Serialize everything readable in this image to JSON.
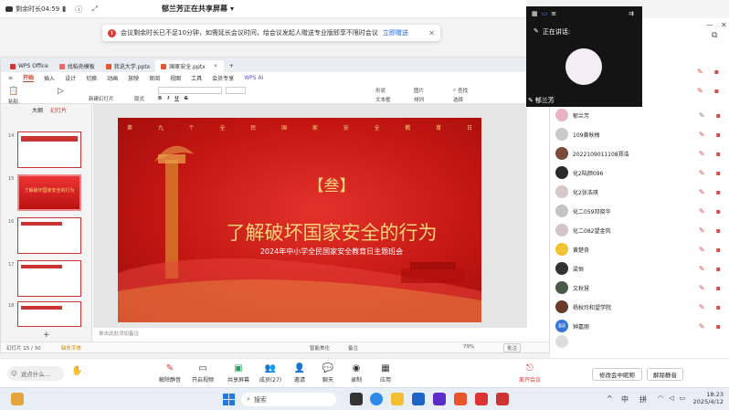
{
  "topbar": {
    "timer": "剩余时长04:59",
    "sharing": "郁兰芳正在共享屏幕"
  },
  "notice": {
    "text": "会议剩余时长已不足10分钟，如需延长会议时间，给会议发起人赠送专业版即享不限时会议",
    "link": "立即赠送"
  },
  "wps": {
    "tabs": [
      {
        "label": "WPS Office"
      },
      {
        "label": "找稻壳模板"
      },
      {
        "label": "我说大学.pptx"
      },
      {
        "label": "国家安全.pptx"
      }
    ],
    "menu": [
      "开始",
      "插入",
      "设计",
      "切换",
      "动画",
      "放映",
      "审阅",
      "视图",
      "工具",
      "会员专享",
      "WPS AI"
    ],
    "ribbon": {
      "paste": "粘贴",
      "new_slide": "新建幻灯片",
      "arrange": "排列",
      "shape": "形状",
      "picture": "图片",
      "textbox": "文本框",
      "find": "查找",
      "layout": "版式",
      "select": "选择"
    },
    "panel": {
      "outline": "大纲",
      "slides": "幻灯片"
    },
    "thumb_numbers": [
      "14",
      "15",
      "16",
      "17",
      "18"
    ],
    "slide": {
      "topline": [
        "第",
        "九",
        "个",
        "全",
        "民",
        "国",
        "家",
        "安",
        "全",
        "教",
        "育",
        "日"
      ],
      "badge": "【叁】",
      "title": "了解破坏国家安全的行为",
      "subtitle": "2024年中小学全民国家安全教育日主题班会"
    },
    "notes": "单击此处添加备注",
    "status": {
      "page": "幻灯片 15 / 30",
      "font": "缺失字体",
      "beautify": "智能美化",
      "notes": "备注",
      "comment": "批注",
      "zoom": "79%"
    }
  },
  "video": {
    "speaking": "正在讲话:",
    "name": "郁兰芳"
  },
  "participants": [
    {
      "name": "郁兰芳",
      "color": "#e9b4c2"
    },
    {
      "name": "109黄秋梅",
      "color": "#c9c9c9"
    },
    {
      "name": "2022109011108郑浩",
      "color": "#7a4a3a"
    },
    {
      "name": "化2陆颜096",
      "color": "#2a2a2a"
    },
    {
      "name": "化2张浩琪",
      "color": "#d7c8c8"
    },
    {
      "name": "化二059邓晓华",
      "color": "#c4c4c4"
    },
    {
      "name": "化二082望金风",
      "color": "#d3c4c6"
    },
    {
      "name": "黄楚奇",
      "color": "#f1c232"
    },
    {
      "name": "梁恒",
      "color": "#333333"
    },
    {
      "name": "文秋慧",
      "color": "#4a5a4a"
    },
    {
      "name": "杨秋玲和望学院",
      "color": "#6a3a2a"
    },
    {
      "name": "钟嘉丽",
      "color": "#3a76d8",
      "initials": "嘉丽"
    }
  ],
  "controls": {
    "mute": "解除静音",
    "video": "开启视频",
    "share": "共享屏幕",
    "members": "成员(27)",
    "invite": "邀请",
    "chat": "聊天",
    "record": "录制",
    "apps": "应用",
    "leave": "离开会议",
    "chat_placeholder": "说点什么...",
    "rename": "修改会中昵称",
    "unmute_all": "解除静音"
  },
  "taskbar": {
    "search": "搜索",
    "lang1": "中",
    "lang2": "拼",
    "time": "18:23",
    "date": "2025/4/12"
  }
}
